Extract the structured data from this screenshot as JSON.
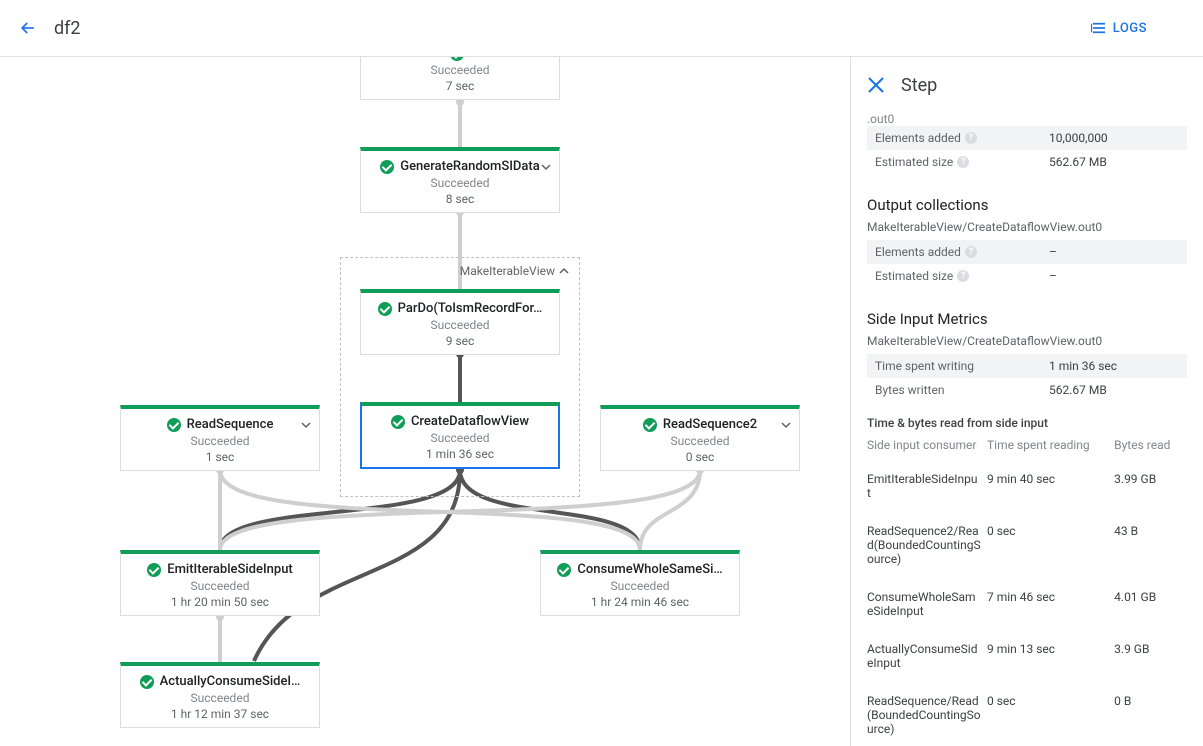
{
  "topbar": {
    "job_name": "df2",
    "logs_label": "LOGS"
  },
  "side": {
    "title": "Step",
    "truncated_top": ".out0",
    "input_metrics": {
      "elements_added_label": "Elements added",
      "elements_added_value": "10,000,000",
      "estimated_size_label": "Estimated size",
      "estimated_size_value": "562.67 MB"
    },
    "output_heading": "Output collections",
    "output_name": "MakeIterableView/CreateDataflowView.out0",
    "output_metrics": {
      "elements_added_label": "Elements added",
      "elements_added_value": "–",
      "estimated_size_label": "Estimated size",
      "estimated_size_value": "–"
    },
    "side_input_heading": "Side Input Metrics",
    "side_input_name": "MakeIterableView/CreateDataflowView.out0",
    "writing": {
      "time_label": "Time spent writing",
      "time_value": "1 min 36 sec",
      "bytes_label": "Bytes written",
      "bytes_value": "562.67 MB"
    },
    "read_heading": "Time & bytes read from side input",
    "read_table_headers": {
      "consumer": "Side input consumer",
      "time": "Time spent reading",
      "bytes": "Bytes read"
    },
    "read_rows": [
      {
        "consumer": "EmitIterableSideInput",
        "time": "9 min 40 sec",
        "bytes": "3.99 GB"
      },
      {
        "consumer": "ReadSequence2/Read(BoundedCountingSource)",
        "time": "0 sec",
        "bytes": "43 B"
      },
      {
        "consumer": "ConsumeWholeSameSideInput",
        "time": "7 min 46 sec",
        "bytes": "4.01 GB"
      },
      {
        "consumer": "ActuallyConsumeSideInput",
        "time": "9 min 13 sec",
        "bytes": "3.9 GB"
      },
      {
        "consumer": "ReadSequence/Read(BoundedCountingSource)",
        "time": "0 sec",
        "bytes": "0 B"
      }
    ]
  },
  "graph": {
    "group_label": "MakeIterableView",
    "nodes": {
      "node0": {
        "title": "",
        "status": "Succeeded",
        "time": "7 sec"
      },
      "node1": {
        "title": "GenerateRandomSIData",
        "status": "Succeeded",
        "time": "8 sec"
      },
      "node2": {
        "title": "ParDo(ToIsmRecordFor…",
        "status": "Succeeded",
        "time": "9 sec"
      },
      "node3": {
        "title": "CreateDataflowView",
        "status": "Succeeded",
        "time": "1 min 36 sec"
      },
      "node4": {
        "title": "ReadSequence",
        "status": "Succeeded",
        "time": "1 sec"
      },
      "node5": {
        "title": "ReadSequence2",
        "status": "Succeeded",
        "time": "0 sec"
      },
      "node6": {
        "title": "EmitIterableSideInput",
        "status": "Succeeded",
        "time": "1 hr 20 min 50 sec"
      },
      "node7": {
        "title": "ConsumeWholeSameSi…",
        "status": "Succeeded",
        "time": "1 hr 24 min 46 sec"
      },
      "node8": {
        "title": "ActuallyConsumeSideI…",
        "status": "Succeeded",
        "time": "1 hr 12 min 37 sec"
      }
    }
  }
}
